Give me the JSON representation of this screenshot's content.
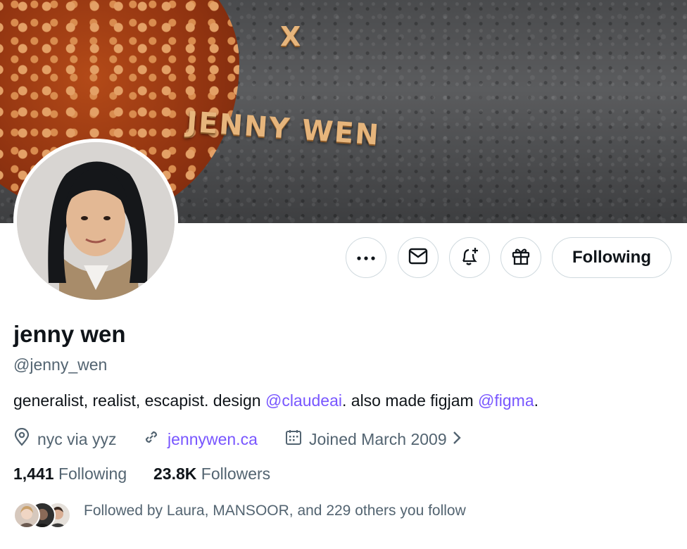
{
  "banner": {
    "pasta_top": "X",
    "pasta_name": "JENNY WEN"
  },
  "profile": {
    "display_name": "jenny wen",
    "handle": "@jenny_wen",
    "bio": {
      "prefix": "generalist, realist, escapist. design ",
      "mention1": "@claudeai",
      "middle": ". also made figjam ",
      "mention2": "@figma",
      "suffix": "."
    },
    "location": "nyc via yyz",
    "website": "jennywen.ca",
    "joined": "Joined March 2009"
  },
  "actions": {
    "more_icon": "more-icon",
    "message_icon": "mail-icon",
    "notify_icon": "bell-plus-icon",
    "gift_icon": "gift-icon",
    "following_label": "Following"
  },
  "stats": {
    "following_count": "1,441",
    "following_label": "Following",
    "followers_count": "23.8K",
    "followers_label": "Followers"
  },
  "followed_by": {
    "text": "Followed by Laura, MANSOOR, and 229 others you follow"
  },
  "colors": {
    "text_primary": "#0f1419",
    "text_secondary": "#536471",
    "link": "#7856ff",
    "border": "#cfd9de"
  }
}
